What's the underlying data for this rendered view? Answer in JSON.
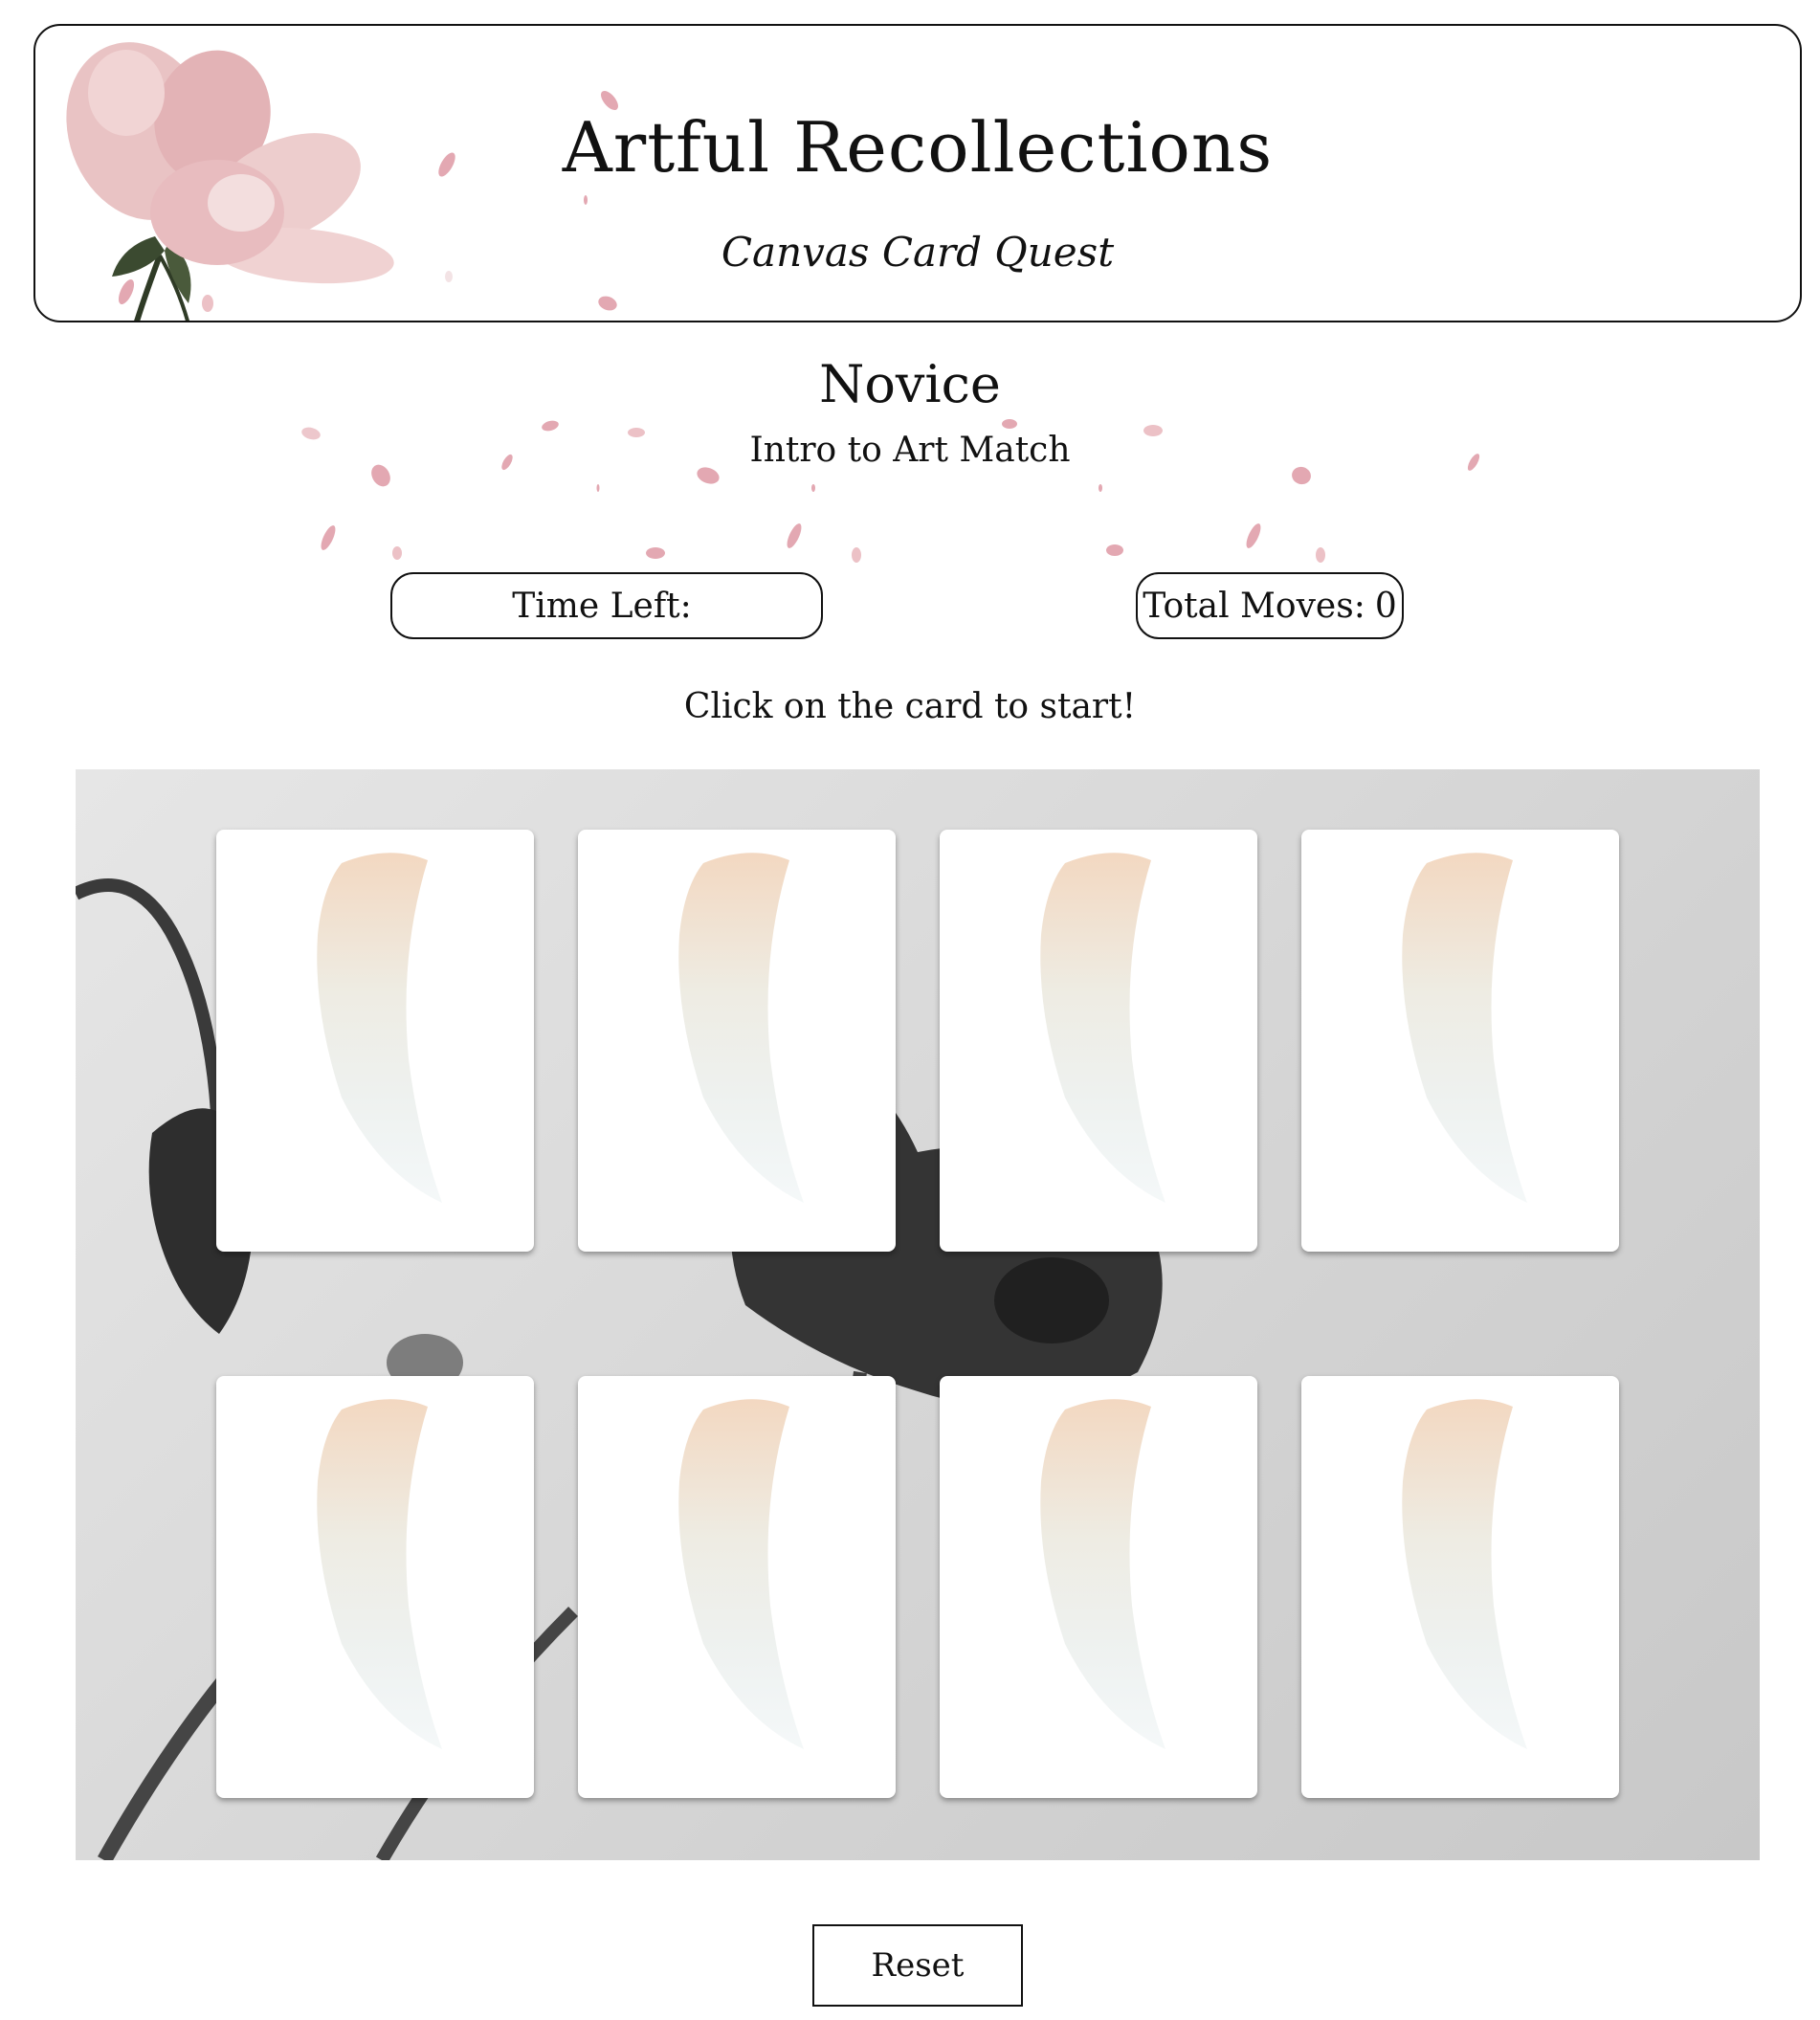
{
  "header": {
    "title": "Artful Recollections",
    "subtitle": "Canvas Card Quest"
  },
  "level": {
    "name": "Novice",
    "description": "Intro to Art Match"
  },
  "stats": {
    "time_label": "Time Left:",
    "time_value": "",
    "moves_label": "Total Moves:",
    "moves_value": "0"
  },
  "instruction": "Click on the card to start!",
  "board": {
    "background": "grayscale-poppy-photo",
    "cards": [
      {
        "face": "down",
        "back_icon": "paint-brush-stroke-icon"
      },
      {
        "face": "down",
        "back_icon": "paint-brush-stroke-icon"
      },
      {
        "face": "down",
        "back_icon": "paint-brush-stroke-icon"
      },
      {
        "face": "down",
        "back_icon": "paint-brush-stroke-icon"
      },
      {
        "face": "down",
        "back_icon": "paint-brush-stroke-icon"
      },
      {
        "face": "down",
        "back_icon": "paint-brush-stroke-icon"
      },
      {
        "face": "down",
        "back_icon": "paint-brush-stroke-icon"
      },
      {
        "face": "down",
        "back_icon": "paint-brush-stroke-icon"
      }
    ]
  },
  "reset_label": "Reset",
  "colors": {
    "petal": "#e7b3bd",
    "flower": "#e9c3c4",
    "leaf": "#3b4a30",
    "stroke_peach": "#f3dcc5",
    "stroke_blue": "#dfe9ea",
    "border": "#111111"
  }
}
